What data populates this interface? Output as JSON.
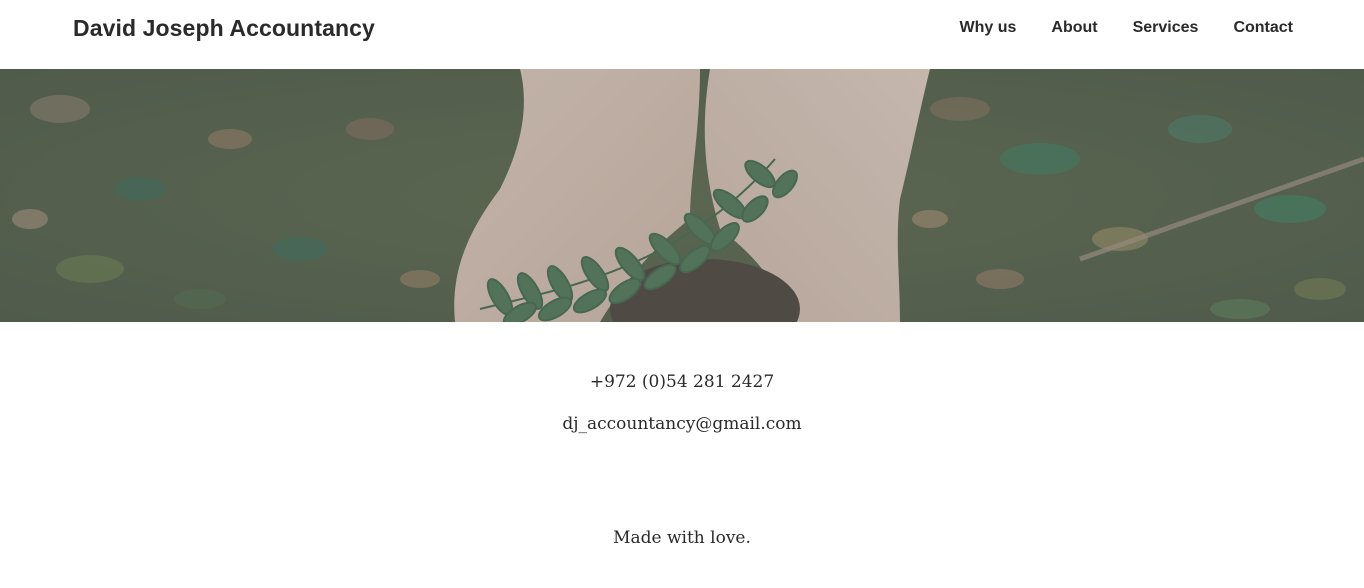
{
  "header": {
    "brand": "David Joseph Accountancy",
    "nav": [
      {
        "label": "Why us"
      },
      {
        "label": "About"
      },
      {
        "label": "Services"
      },
      {
        "label": "Contact"
      }
    ]
  },
  "hero": {
    "image": "hands-holding-soil-with-seedling",
    "overlay_color": "#8a8a8a"
  },
  "contact": {
    "phone": "+972 (0)54 281 2427",
    "email": "dj_accountancy@gmail.com"
  },
  "footer": {
    "text": "Made with love."
  },
  "colors": {
    "text": "#2a2a2a",
    "background": "#ffffff"
  }
}
